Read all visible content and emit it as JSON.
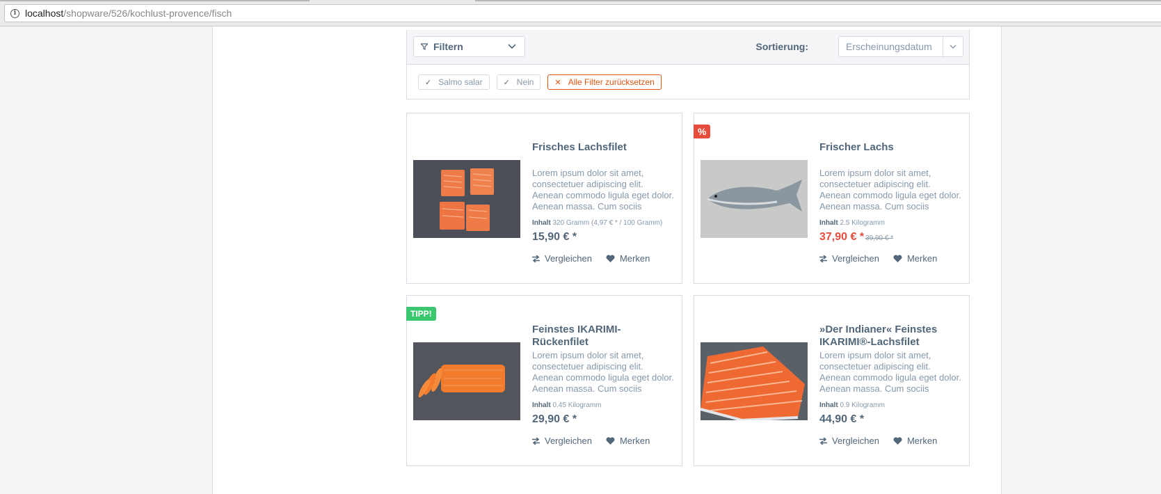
{
  "browser": {
    "url_host": "localhost",
    "url_path": "/shopware/526/kochlust-provence/fisch"
  },
  "filter": {
    "button_label": "Filtern",
    "sort_label": "Sortierung:",
    "sort_value": "Erscheinungsdatum",
    "active_filters": [
      {
        "label": "Salmo salar"
      },
      {
        "label": "Nein"
      }
    ],
    "reset_label": "Alle Filter zurücksetzen"
  },
  "products": [
    {
      "title": "Frisches Lachsfilet",
      "description": "Lorem ipsum dolor sit amet, consectetuer adipiscing elit. Aenean commodo ligula eget dolor. Aenean massa. Cum sociis",
      "unit_label": "Inhalt",
      "unit_value": "320 Gramm (4,97 € * / 100 Gramm)",
      "price": "15,90 € *",
      "old_price": "",
      "badge": "",
      "compare_label": "Vergleichen",
      "wishlist_label": "Merken"
    },
    {
      "title": "Frischer Lachs",
      "description": "Lorem ipsum dolor sit amet, consectetuer adipiscing elit. Aenean commodo ligula eget dolor. Aenean massa. Cum sociis",
      "unit_label": "Inhalt",
      "unit_value": "2.5 Kilogramm",
      "price": "37,90 € *",
      "old_price": "39,90 € *",
      "badge": "%",
      "compare_label": "Vergleichen",
      "wishlist_label": "Merken"
    },
    {
      "title": "Feinstes IKARIMI-Rückenfilet",
      "description": "Lorem ipsum dolor sit amet, consectetuer adipiscing elit. Aenean commodo ligula eget dolor. Aenean massa. Cum sociis",
      "unit_label": "Inhalt",
      "unit_value": "0.45 Kilogramm",
      "price": "29,90 € *",
      "old_price": "",
      "badge": "TIPP!",
      "compare_label": "Vergleichen",
      "wishlist_label": "Merken"
    },
    {
      "title": "»Der Indianer« Feinstes IKARIMI®-Lachsfilet",
      "description": "Lorem ipsum dolor sit amet, consectetuer adipiscing elit. Aenean commodo ligula eget dolor. Aenean massa. Cum sociis",
      "unit_label": "Inhalt",
      "unit_value": "0.9 Kilogramm",
      "price": "44,90 € *",
      "old_price": "",
      "badge": "",
      "compare_label": "Vergleichen",
      "wishlist_label": "Merken"
    }
  ],
  "colors": {
    "accent": "#e1540f",
    "discount": "#e74c3c",
    "tip": "#3bc770",
    "text": "#52667a"
  }
}
